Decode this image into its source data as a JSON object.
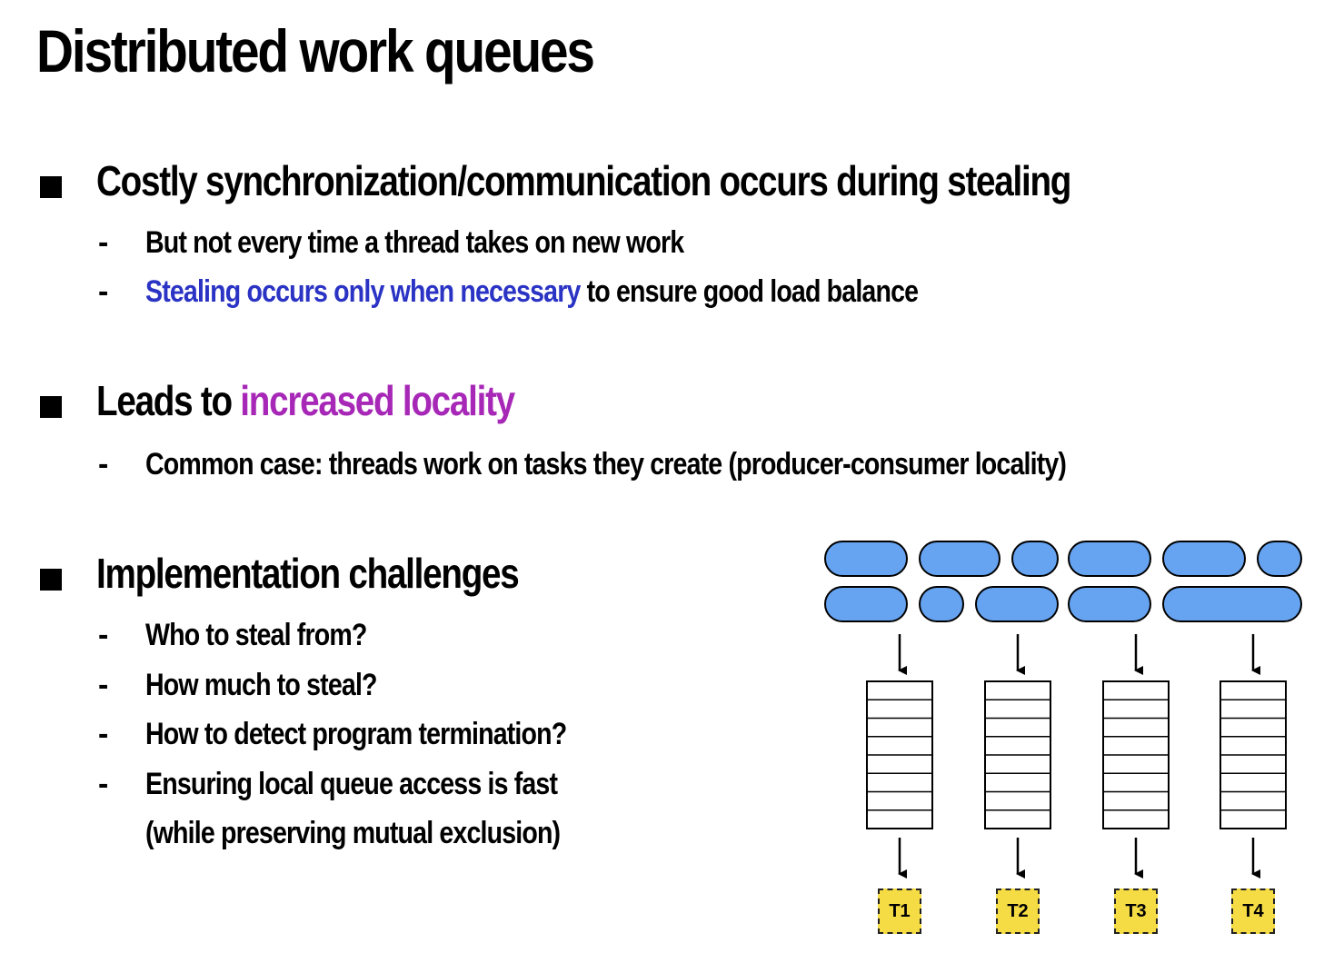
{
  "slide": {
    "title": "Distributed work queues",
    "sections": [
      {
        "heading": "Costly synchronization/communication occurs during stealing",
        "items": [
          {
            "text": "But not every time a thread takes on new work"
          },
          {
            "highlight": "Stealing occurs only when necessary",
            "rest": " to ensure good load balance",
            "highlight_color": "#2a33c4"
          }
        ]
      },
      {
        "heading_prefix": "Leads to ",
        "heading_highlight": "increased locality",
        "highlight_color": "#a728b7",
        "items": [
          {
            "text": "Common case: threads work on tasks they create (producer-consumer locality)"
          }
        ]
      },
      {
        "heading": "Implementation challenges",
        "items": [
          {
            "text": "Who to steal from?"
          },
          {
            "text": "How much to steal?"
          },
          {
            "text": "How to detect program termination?"
          },
          {
            "text": "Ensuring local queue access is fast"
          },
          {
            "text": "(while preserving mutual exclusion)"
          }
        ]
      }
    ],
    "bullet_dash": "-"
  },
  "diagram": {
    "task_color": "#66a3f0",
    "label_color": "#f5dc44",
    "threads": [
      "T1",
      "T2",
      "T3",
      "T4"
    ],
    "queue_slots": 8
  }
}
